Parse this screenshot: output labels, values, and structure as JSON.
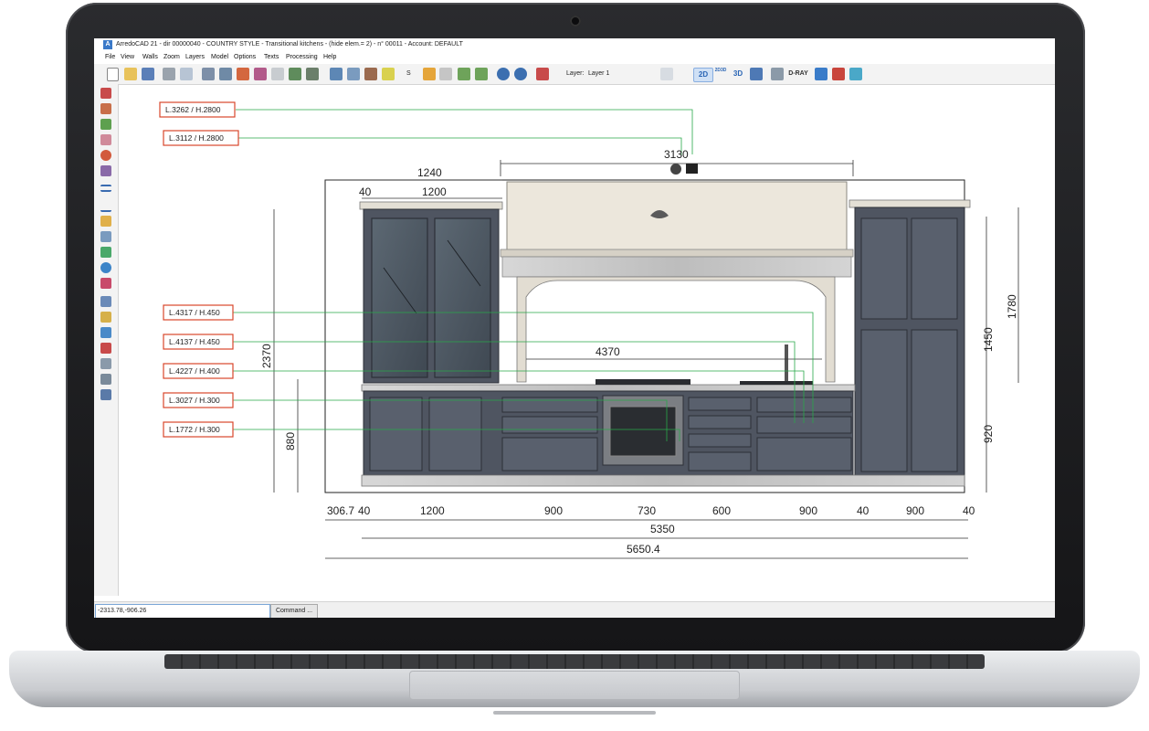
{
  "window": {
    "title": "ArredoCAD 21 - dir 00000040 - COUNTRY STYLE - Transitional  kitchens - (hide elem.= 2)  - n° 00011 - Account: DEFAULT",
    "app_icon": "A"
  },
  "menu": [
    "File",
    "View",
    "Walls",
    "Zoom",
    "Layers",
    "Model",
    "Options",
    "Texts",
    "Processing",
    "Help"
  ],
  "toolbar": {
    "layer_label": "Layer:",
    "layer_value": "Layer 1",
    "s_label": "S",
    "btn_2d": "2D",
    "btn_2d3d": "2D3D",
    "btn_3d": "3D",
    "btn_dray": "D-RAY"
  },
  "status": {
    "coordinates": "-2313.78,-906.26",
    "command_button": "Command ..."
  },
  "drawing": {
    "labels": [
      "L.3262 / H.2800",
      "L.3112 / H.2800",
      "L.4317 / H.450",
      "L.4137 / H.450",
      "L.4227 / H.400",
      "L.3027 / H.300",
      "L.1772 / H.300"
    ],
    "dims_top": {
      "hood": "3130",
      "left_total": "1240",
      "left_gap": "40",
      "left_width": "1200"
    },
    "dims_inner": {
      "counter": "4370"
    },
    "dims_left": {
      "total_height": "2370",
      "base_height": "880"
    },
    "dims_right": {
      "tall_total": "1780",
      "tall_upper": "1450",
      "tall_lower": "920"
    },
    "dims_bottom": [
      "306.7",
      "40",
      "1200",
      "900",
      "730",
      "600",
      "900",
      "40",
      "900",
      "40"
    ],
    "dim_total_inner": "5350",
    "dim_total_overall": "5650.4"
  },
  "colors": {
    "cabinet": "#4f5561",
    "cabinet_dark": "#3b404a",
    "hood": "#ede8dd",
    "marble": "#c9c9c9",
    "label_border": "#d9472b",
    "leader": "#29a84a",
    "dim_line": "#333333",
    "active_2d": "#cfe0f5"
  },
  "icons": [
    "new-icon",
    "open-icon",
    "save-icon",
    "print-icon",
    "preview-icon",
    "walls-icon",
    "cube-icon",
    "undo-icon",
    "redo-icon",
    "render-icon"
  ]
}
